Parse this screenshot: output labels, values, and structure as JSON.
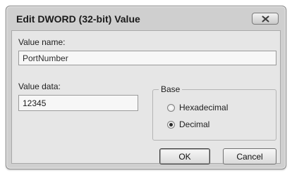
{
  "dialog": {
    "title": "Edit DWORD (32-bit) Value",
    "close_icon": "close-x-icon"
  },
  "value_name": {
    "label": "Value name:",
    "value": "PortNumber"
  },
  "value_data": {
    "label": "Value data:",
    "value": "12345"
  },
  "base": {
    "legend": "Base",
    "options": [
      {
        "label": "Hexadecimal",
        "selected": false
      },
      {
        "label": "Decimal",
        "selected": true
      }
    ]
  },
  "buttons": {
    "ok": "OK",
    "cancel": "Cancel"
  }
}
